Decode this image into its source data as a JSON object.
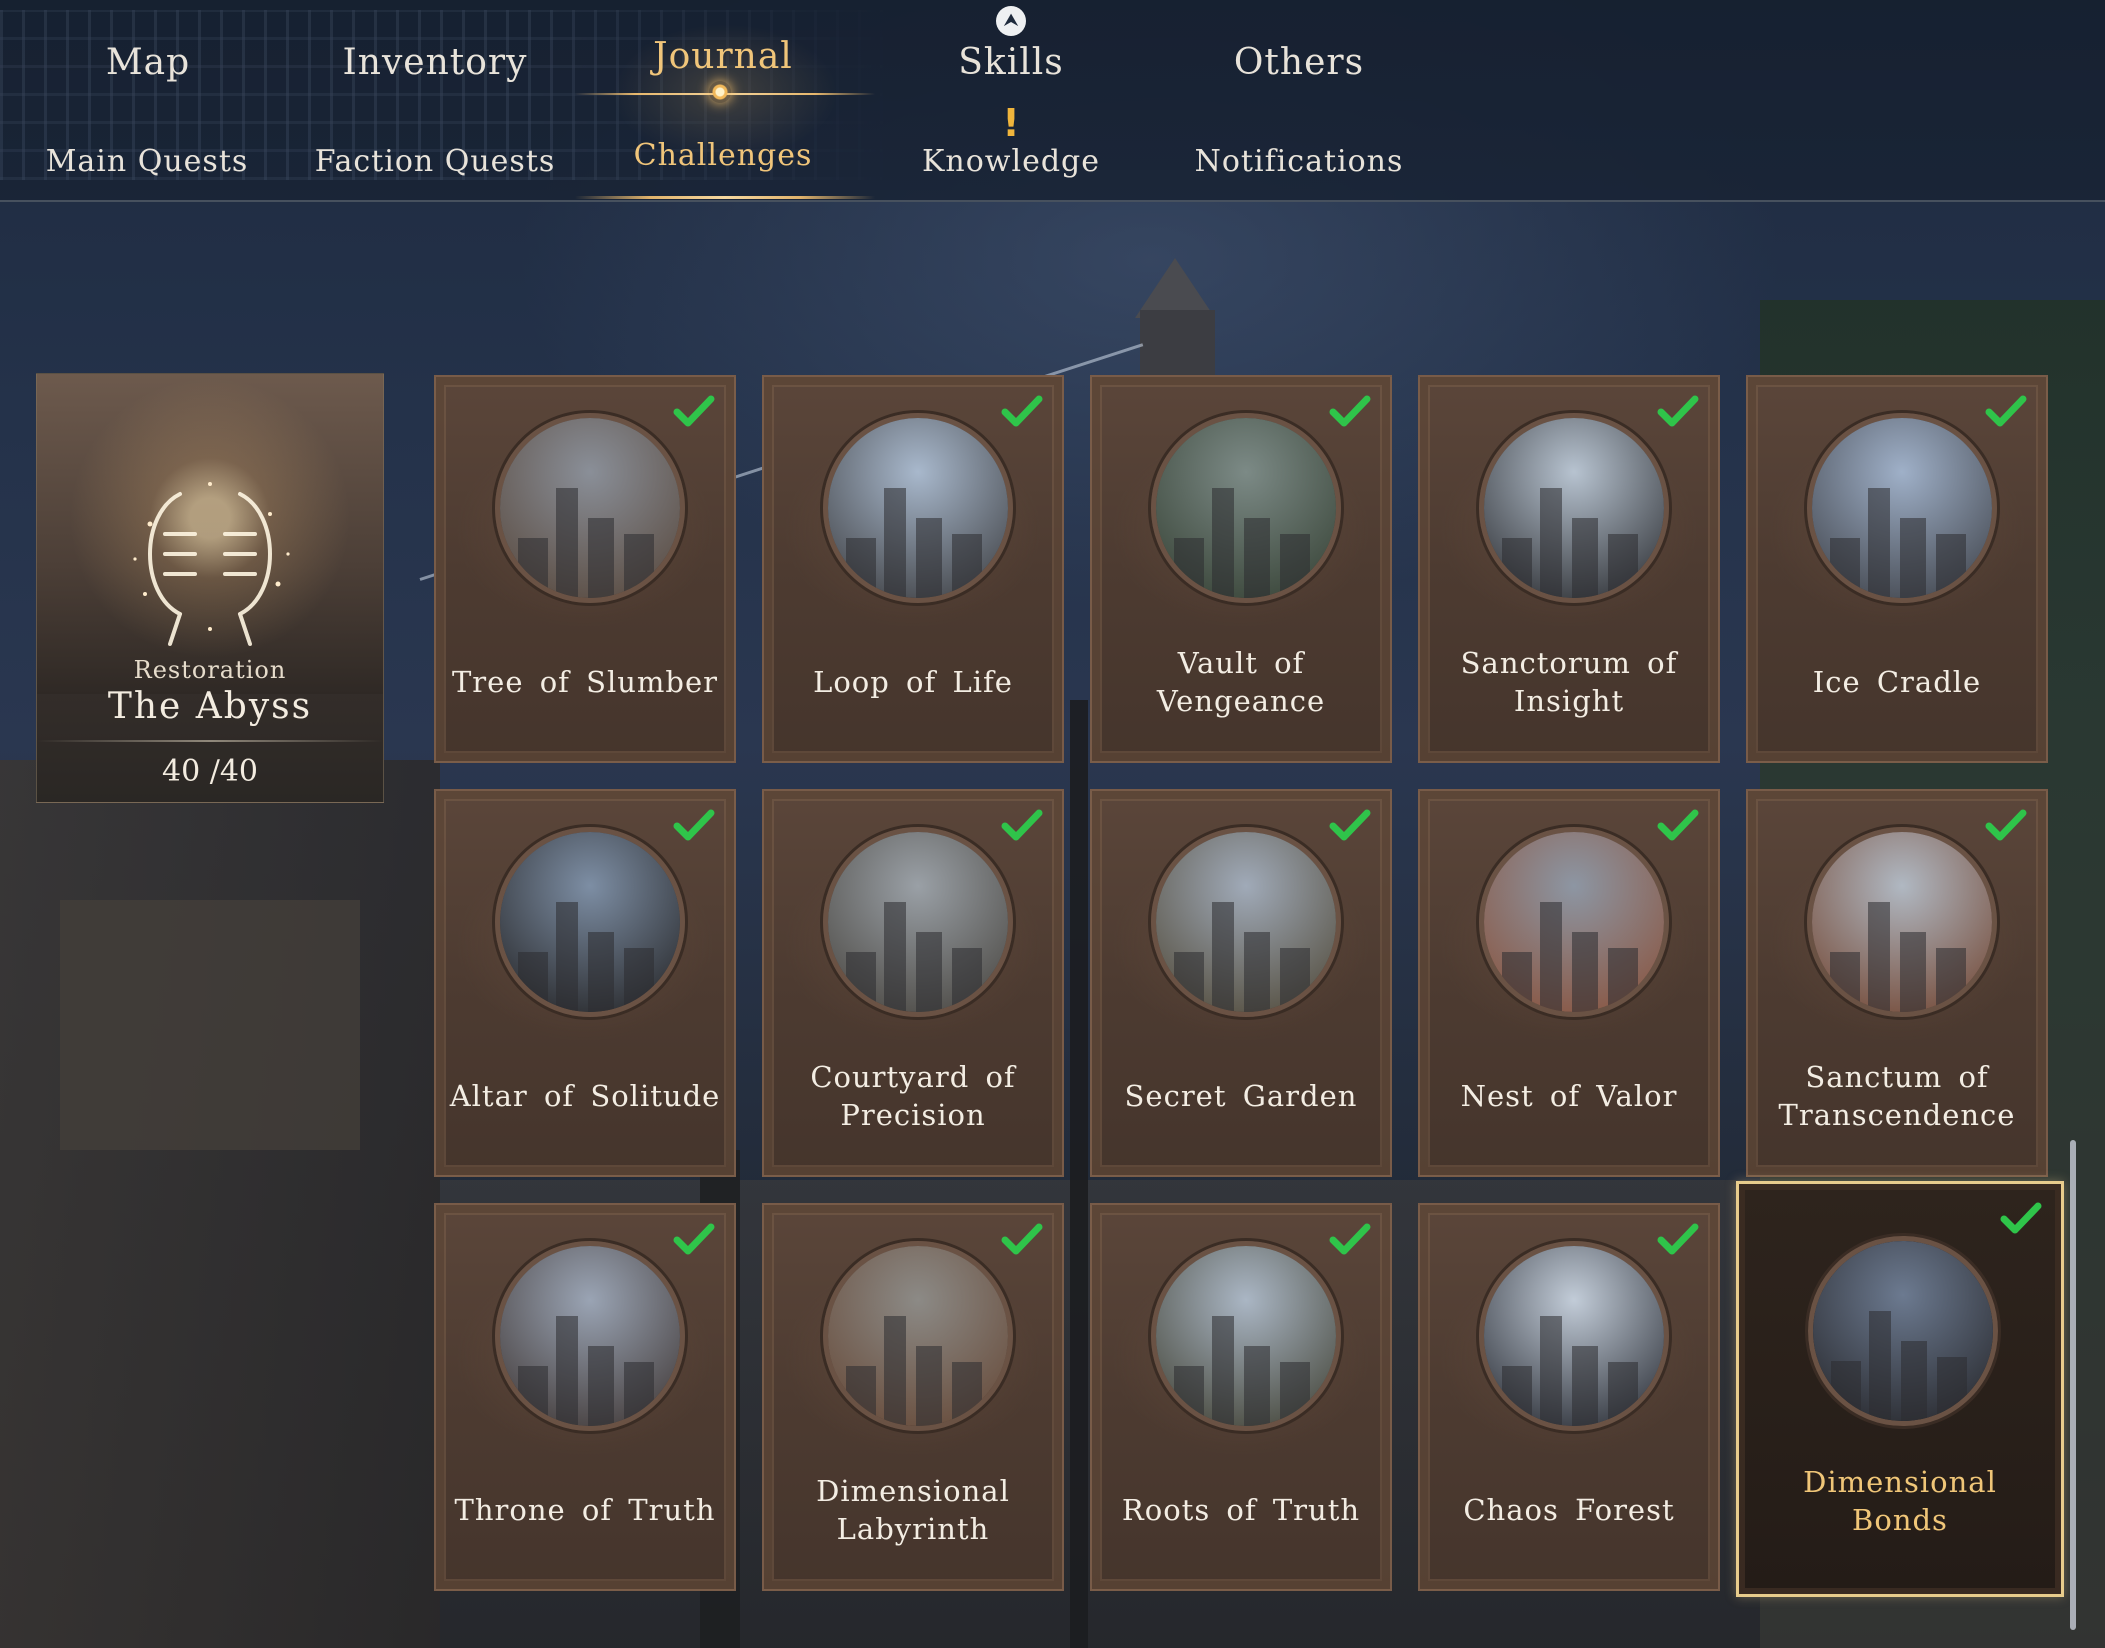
{
  "nav": {
    "main_tabs": [
      {
        "label": "Map"
      },
      {
        "label": "Inventory"
      },
      {
        "label": "Journal"
      },
      {
        "label": "Skills"
      },
      {
        "label": "Others"
      }
    ],
    "active_main_tab": "Journal",
    "sub_tabs": [
      {
        "label": "Main Quests"
      },
      {
        "label": "Faction Quests"
      },
      {
        "label": "Challenges"
      },
      {
        "label": "Knowledge"
      },
      {
        "label": "Notifications"
      }
    ],
    "active_sub_tab": "Challenges",
    "skills_icon": "up-arrow-circle-icon",
    "knowledge_badge": "!"
  },
  "summary": {
    "subtitle": "Restoration",
    "title": "The Abyss",
    "progress_text": "40 /40",
    "completed": 40,
    "total": 40
  },
  "challenges": [
    {
      "name": "Tree of Slumber",
      "completed": true
    },
    {
      "name": "Loop of Life",
      "completed": true
    },
    {
      "name": "Vault of Vengeance",
      "completed": true
    },
    {
      "name": "Sanctorum of Insight",
      "completed": true
    },
    {
      "name": "Ice Cradle",
      "completed": true
    },
    {
      "name": "Altar of Solitude",
      "completed": true
    },
    {
      "name": "Courtyard of Precision",
      "completed": true
    },
    {
      "name": "Secret Garden",
      "completed": true
    },
    {
      "name": "Nest of Valor",
      "completed": true
    },
    {
      "name": "Sanctum of Transcendence",
      "completed": true
    },
    {
      "name": "Throne of Truth",
      "completed": true
    },
    {
      "name": "Dimensional Labyrinth",
      "completed": true
    },
    {
      "name": "Roots of Truth",
      "completed": true
    },
    {
      "name": "Chaos Forest",
      "completed": true
    },
    {
      "name": "Dimensional Bonds",
      "completed": true,
      "selected": true
    }
  ],
  "colors": {
    "accent_gold": "#f0c57a",
    "check_green": "#2fc44a",
    "card_brown": "#4d3b31",
    "selected_border": "#e8cc8c"
  }
}
